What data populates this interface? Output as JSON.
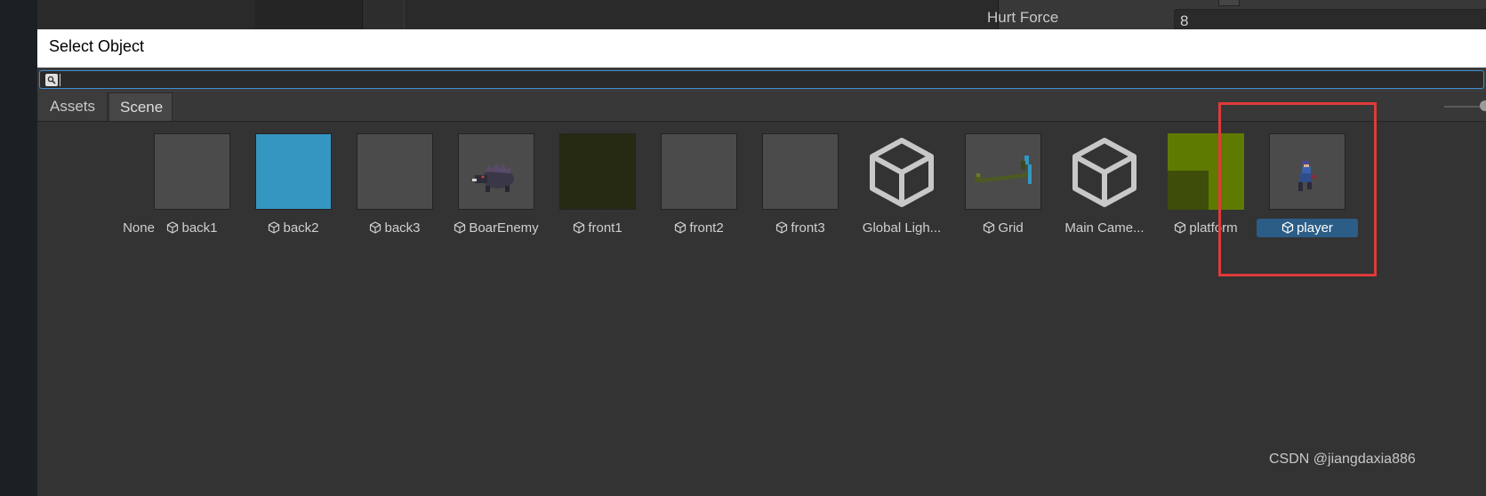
{
  "background_editor": {
    "hurt_force_label": "Hurt Force",
    "hurt_force_value": "8"
  },
  "dialog": {
    "title": "Select Object",
    "search": {
      "value": "",
      "placeholder": ""
    },
    "tabs": [
      {
        "label": "Assets",
        "selected": false
      },
      {
        "label": "Scene",
        "selected": true
      }
    ],
    "items": [
      {
        "label": "None",
        "thumb_color": "",
        "icon": "none",
        "prefab_icon": false,
        "selected": false
      },
      {
        "label": "back1",
        "thumb_color": "#4b4b4b",
        "icon": "blank-thumbnail",
        "prefab_icon": true,
        "selected": false
      },
      {
        "label": "back2",
        "thumb_color": "#3596c2",
        "icon": "blue-square-thumbnail",
        "prefab_icon": true,
        "selected": false
      },
      {
        "label": "back3",
        "thumb_color": "#4b4b4b",
        "icon": "blank-thumbnail",
        "prefab_icon": true,
        "selected": false
      },
      {
        "label": "BoarEnemy",
        "thumb_color": "#4b4b4b",
        "icon": "boar-sprite-thumbnail",
        "prefab_icon": true,
        "selected": false
      },
      {
        "label": "front1",
        "thumb_color": "#272a12",
        "icon": "dark-green-thumbnail",
        "prefab_icon": true,
        "selected": false
      },
      {
        "label": "front2",
        "thumb_color": "#4b4b4b",
        "icon": "blank-thumbnail",
        "prefab_icon": true,
        "selected": false
      },
      {
        "label": "front3",
        "thumb_color": "#4b4b4b",
        "icon": "blank-thumbnail",
        "prefab_icon": true,
        "selected": false
      },
      {
        "label": "Global Ligh...",
        "thumb_color": "",
        "icon": "cube-icon",
        "prefab_icon": false,
        "selected": false
      },
      {
        "label": "Grid",
        "thumb_color": "#4b4b4b",
        "icon": "grid-platform-thumbnail",
        "prefab_icon": true,
        "selected": false
      },
      {
        "label": "Main Came...",
        "thumb_color": "",
        "icon": "cube-icon",
        "prefab_icon": false,
        "selected": false
      },
      {
        "label": "platform",
        "thumb_color": "#5e7a00",
        "icon": "platform-thumbnail",
        "prefab_icon": true,
        "selected": false
      },
      {
        "label": "player",
        "thumb_color": "#4b4b4b",
        "icon": "player-sprite-thumbnail",
        "prefab_icon": true,
        "selected": true
      }
    ]
  },
  "highlight_color": "#e03a3a",
  "selection_color": "#2c5d87",
  "watermark": "CSDN @jiangdaxia886"
}
